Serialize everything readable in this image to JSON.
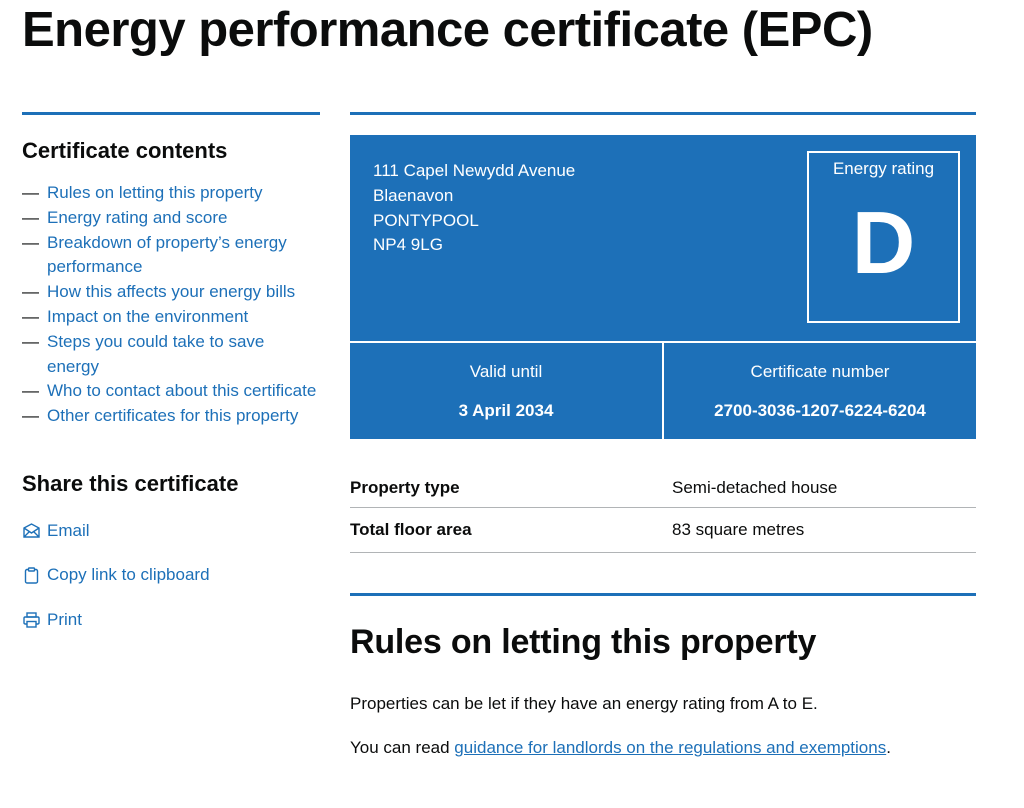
{
  "page_title": "Energy performance certificate (EPC)",
  "sidebar": {
    "contents_title": "Certificate contents",
    "contents": [
      "Rules on letting this property",
      "Energy rating and score",
      "Breakdown of property’s energy performance",
      "How this affects your energy bills",
      "Impact on the environment",
      "Steps you could take to save energy",
      "Who to contact about this certificate",
      "Other certificates for this property"
    ],
    "share_title": "Share this certificate",
    "share": {
      "email": "Email",
      "copy": "Copy link to clipboard",
      "print": "Print"
    }
  },
  "epc": {
    "address": [
      "111 Capel Newydd Avenue",
      "Blaenavon",
      "PONTYPOOL",
      "NP4 9LG"
    ],
    "rating_label": "Energy rating",
    "rating": "D",
    "valid_label": "Valid until",
    "valid_value": "3 April 2034",
    "cert_label": "Certificate number",
    "cert_value": "2700-3036-1207-6224-6204"
  },
  "summary": {
    "property_type_label": "Property type",
    "property_type_value": "Semi-detached house",
    "floor_area_label": "Total floor area",
    "floor_area_value": "83 square metres"
  },
  "rules": {
    "heading": "Rules on letting this property",
    "p1": "Properties can be let if they have an energy rating from A to E.",
    "p2_prefix": "You can read ",
    "p2_link": "guidance for landlords on the regulations and exemptions",
    "p2_suffix": "."
  },
  "colors": {
    "brand_blue": "#1d70b8",
    "text": "#0b0c0c",
    "divider": "#b1b4b6"
  }
}
